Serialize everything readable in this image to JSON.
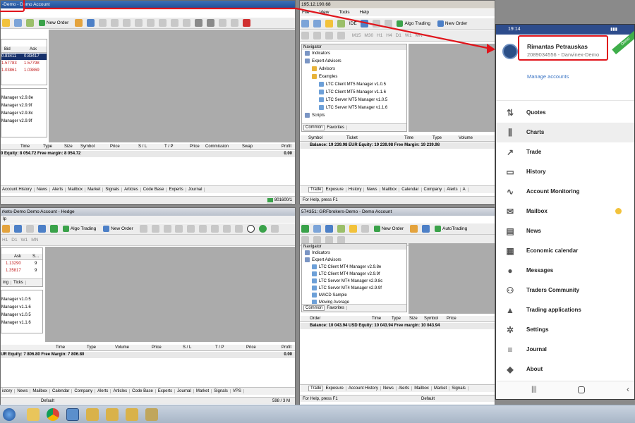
{
  "top_left_window": {
    "title": "-Demo - Demo Account",
    "toolbar": {
      "new_order": "New Order"
    },
    "market_watch": {
      "headers": [
        "Bid",
        "Ask"
      ],
      "rows": [
        {
          "bid": "0.83411",
          "ask": "0.83417"
        },
        {
          "bid": "1.57783",
          "ask": "1.57798"
        },
        {
          "bid": "1.03861",
          "ask": "1.03869"
        }
      ]
    },
    "nav_items": [
      "Manager v2.9.8e",
      "Manager v2.9.9f",
      "Manager v2.9.8c",
      "Manager v2.9.9f"
    ],
    "trade_headers": [
      "Time",
      "Type",
      "Size",
      "Symbol",
      "Price",
      "S / L",
      "T / P",
      "Price",
      "Commission",
      "Swap",
      "Profit"
    ],
    "balance_line": "0   Equity: 8 054.72   Free margin: 8 054.72",
    "balance_profit": "0.00",
    "tabs": [
      "Account History",
      "News",
      "Alerts",
      "Mailbox",
      "Market",
      "Signals",
      "Articles",
      "Code Base",
      "Experts",
      "Journal"
    ],
    "status_right": "801600/1"
  },
  "top_mid_window": {
    "title": "195.12.190.68",
    "menu": [
      "File",
      "View",
      "Tools",
      "Help"
    ],
    "toolbar": {
      "ide": "IDE",
      "algo_trading": "Algo Trading",
      "new_order": "New Order",
      "timeframes": [
        "M15",
        "M30",
        "H1",
        "H4",
        "D1",
        "W1",
        "MN"
      ]
    },
    "navigator": {
      "title": "Navigator",
      "items": [
        {
          "label": "Indicators",
          "level": 1
        },
        {
          "label": "Expert Advisors",
          "level": 1
        },
        {
          "label": "Advisors",
          "level": 2
        },
        {
          "label": "Examples",
          "level": 2
        },
        {
          "label": "LTC Client MT5 Manager v1.0.5",
          "level": 3
        },
        {
          "label": "LTC Client MT5 Manager v1.1.6",
          "level": 3
        },
        {
          "label": "LTC Server MT5 Manager v1.0.5",
          "level": 3
        },
        {
          "label": "LTC Server MT5 Manager v1.1.6",
          "level": 3
        },
        {
          "label": "Scripts",
          "level": 1
        }
      ],
      "tabs": [
        "Common",
        "Favorites"
      ]
    },
    "trade_headers": [
      "Symbol",
      "Ticket",
      "Time",
      "Type",
      "Volume"
    ],
    "balance_line": "Balance: 19 239.98 EUR  Equity: 19 239.98  Free Margin: 19 239.98",
    "tabs": [
      "Trade",
      "Exposure",
      "History",
      "News",
      "Mailbox",
      "Calendar",
      "Company",
      "Alerts",
      "A"
    ],
    "status_left": "For Help, press F1"
  },
  "bottom_left_window": {
    "title": "rkets-Demo Demo Account - Hedge",
    "menu": [
      "lp"
    ],
    "toolbar": {
      "algo_trading": "Algo Trading",
      "new_order": "New Order",
      "timeframes": [
        "H1",
        "D1",
        "W1",
        "MN"
      ]
    },
    "market_watch": {
      "headers": [
        "Ask",
        "S..."
      ],
      "rows": [
        {
          "ask": "1.13290",
          "s": "9"
        },
        {
          "ask": "1.35817",
          "s": "9"
        }
      ],
      "tabs": [
        "ing",
        "Ticks"
      ]
    },
    "nav_items": [
      "Manager v1.0.5",
      "Manager v1.1.6",
      "Manager v1.0.5",
      "Manager v1.1.6"
    ],
    "trade_headers": [
      "Time",
      "Type",
      "Volume",
      "Price",
      "S / L",
      "T / P",
      "Price",
      "Profit"
    ],
    "balance_line": "UR  Equity: 7 806.80  Free Margin: 7 806.80",
    "balance_profit": "0.00",
    "tabs": [
      "istory",
      "News",
      "Mailbox",
      "Calendar",
      "Company",
      "Alerts",
      "Articles",
      "Code Base",
      "Experts",
      "Journal",
      "Market",
      "Signals",
      "VPS"
    ],
    "status_mid": "Default",
    "status_right": "598 / 3 M"
  },
  "bottom_mid_window": {
    "title": "574351: GRFbrokers-Demo - Demo Account",
    "toolbar": {
      "new_order": "New Order",
      "autotrading": "AutoTrading"
    },
    "navigator": {
      "title": "Navigator",
      "items": [
        {
          "label": "Indicators",
          "level": 1
        },
        {
          "label": "Expert Advisors",
          "level": 1
        },
        {
          "label": "LTC Client MT4 Manager v2.9.8e",
          "level": 2
        },
        {
          "label": "LTC Client MT4 Manager v2.9.9f",
          "level": 2
        },
        {
          "label": "LTC Server MT4 Manager v2.9.8c",
          "level": 2
        },
        {
          "label": "LTC Server MT4 Manager v2.9.9f",
          "level": 2
        },
        {
          "label": "MACD Sample",
          "level": 2
        },
        {
          "label": "Moving Average",
          "level": 2
        }
      ],
      "tabs": [
        "Common",
        "Favorites"
      ]
    },
    "trade_headers": [
      "Order",
      "Time",
      "Type",
      "Size",
      "Symbol",
      "Price"
    ],
    "balance_line": "Balance: 10 043.94 USD  Equity: 10 043.94  Free margin: 10 043.94",
    "tabs": [
      "Trade",
      "Exposure",
      "Account History",
      "News",
      "Alerts",
      "Mailbox",
      "Market",
      "Signals"
    ],
    "status_left": "For Help, press F1",
    "status_mid": "Default"
  },
  "phone": {
    "time": "19:14",
    "account_name": "Rimantas Petrauskas",
    "account_id": "2089034556 - Darwinex-Demo",
    "badge": "Demo",
    "manage_accounts": "Manage accounts",
    "menu": [
      {
        "label": "Quotes",
        "icon": "quotes-icon",
        "glyph": "⇅"
      },
      {
        "label": "Charts",
        "icon": "charts-icon",
        "glyph": "⫼",
        "selected": true
      },
      {
        "label": "Trade",
        "icon": "trade-icon",
        "glyph": "↗"
      },
      {
        "label": "History",
        "icon": "history-icon",
        "glyph": "▭"
      },
      {
        "label": "Account Monitoring",
        "icon": "monitoring-icon",
        "glyph": "∿"
      },
      {
        "label": "Mailbox",
        "icon": "mailbox-icon",
        "glyph": "✉",
        "dot": true
      },
      {
        "label": "News",
        "icon": "news-icon",
        "glyph": "▤"
      },
      {
        "label": "Economic calendar",
        "icon": "calendar-icon",
        "glyph": "▦"
      },
      {
        "label": "Messages",
        "icon": "messages-icon",
        "glyph": "●"
      },
      {
        "label": "Traders Community",
        "icon": "community-icon",
        "glyph": "⚇"
      },
      {
        "label": "Trading applications",
        "icon": "apps-icon",
        "glyph": "▲"
      },
      {
        "label": "Settings",
        "icon": "settings-icon",
        "glyph": "✲"
      },
      {
        "label": "Journal",
        "icon": "journal-icon",
        "glyph": "≡"
      },
      {
        "label": "About",
        "icon": "about-icon",
        "glyph": "◆"
      }
    ]
  },
  "colors": {
    "highlight_red": "#e0141b",
    "title_blue": "#1f4e97",
    "phone_status": "#2d4c8c",
    "link_blue": "#3a74c4"
  }
}
